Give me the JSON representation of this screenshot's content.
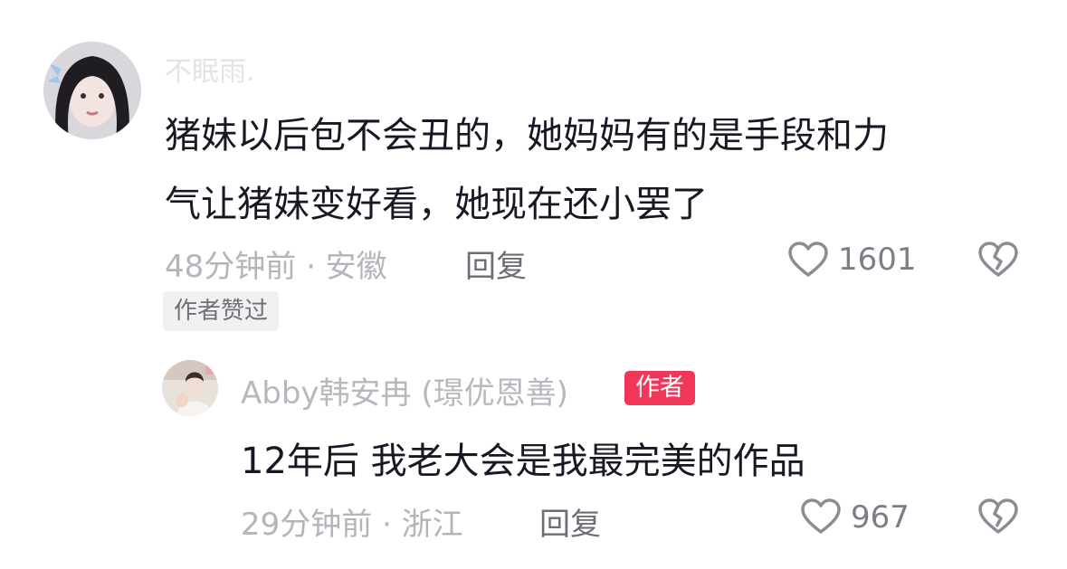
{
  "comment": {
    "username": "不眠雨.",
    "text_line_1": "猪妹以后包不会丑的，她妈妈有的是手段和力",
    "text_line_2": "气让猪妹变好看，她现在还小罢了",
    "meta": "48分钟前 · 安徽",
    "reply_label": "回复",
    "like_count": "1601",
    "author_liked_badge": "作者赞过"
  },
  "reply": {
    "username": "Abby韩安冉 (璟优恩善)",
    "author_badge": "作者",
    "text": "12年后 我老大会是我最完美的作品",
    "meta": "29分钟前 · 浙江",
    "reply_label": "回复",
    "like_count": "967"
  },
  "icons": {
    "like": "heart-outline-icon",
    "dislike": "broken-heart-icon",
    "avatar": "user-avatar"
  },
  "colors": {
    "author_badge_bg": "#f2365a",
    "text": "#161823",
    "meta": "#b3b5ba"
  }
}
